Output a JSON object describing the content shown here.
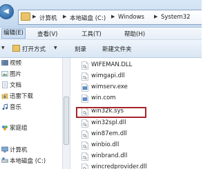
{
  "address": {
    "crumbs": [
      "计算机",
      "本地磁盘 (C:)",
      "Windows",
      "System32"
    ]
  },
  "menu": {
    "items": [
      {
        "label": "编辑(E)",
        "active": true
      },
      {
        "label": "查看(V)",
        "active": false
      },
      {
        "label": "工具(T)",
        "active": false
      },
      {
        "label": "帮助(H)",
        "active": false
      }
    ]
  },
  "toolbar": {
    "open_label": "打开方式",
    "burn_label": "刻录",
    "new_folder_label": "新建文件夹"
  },
  "sidebar": {
    "items": [
      {
        "label": "视频",
        "icon": "video-icon"
      },
      {
        "label": "图片",
        "icon": "picture-icon"
      },
      {
        "label": "文档",
        "icon": "document-icon"
      },
      {
        "label": "迅雷下载",
        "icon": "download-icon"
      },
      {
        "label": "音乐",
        "icon": "music-icon"
      },
      {
        "label": "家庭组",
        "icon": "homegroup-icon"
      },
      {
        "label": "计算机",
        "icon": "computer-icon"
      },
      {
        "label": "本地磁盘 (C:)",
        "icon": "drive-icon"
      }
    ]
  },
  "files": [
    {
      "name": "WIFEMAN.DLL",
      "type": "dll"
    },
    {
      "name": "wimgapi.dll",
      "type": "dll"
    },
    {
      "name": "wimserv.exe",
      "type": "exe"
    },
    {
      "name": "win.com",
      "type": "com"
    },
    {
      "name": "win32k.sys",
      "type": "sys",
      "highlighted": true
    },
    {
      "name": "win32spl.dll",
      "type": "dll"
    },
    {
      "name": "win87em.dll",
      "type": "dll"
    },
    {
      "name": "winbio.dll",
      "type": "dll"
    },
    {
      "name": "winbrand.dll",
      "type": "dll"
    },
    {
      "name": "wincredprovider.dll",
      "type": "dll"
    }
  ],
  "colors": {
    "highlight_border": "#a4242a",
    "folder": "#e9c46a",
    "accent_blue": "#1d5a9c"
  }
}
